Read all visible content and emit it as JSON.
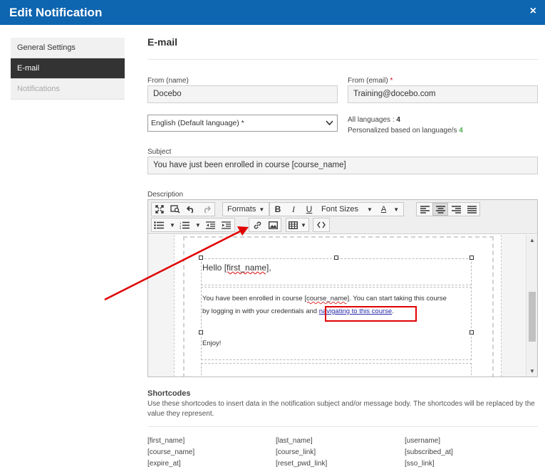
{
  "window": {
    "title": "Edit Notification",
    "close_glyph": "×"
  },
  "sidebar": {
    "items": [
      {
        "label": "General Settings",
        "state": "normal"
      },
      {
        "label": "E-mail",
        "state": "active"
      },
      {
        "label": "Notifications",
        "state": "disabled"
      }
    ]
  },
  "main": {
    "section_title": "E-mail",
    "from_name": {
      "label": "From (name)",
      "value": "Docebo"
    },
    "from_email": {
      "label": "From (email)",
      "required_mark": "*",
      "value": "Training@docebo.com"
    },
    "language": {
      "selected": "English (Default language) *"
    },
    "lang_info": {
      "all_label": "All languages :",
      "all_count": "4",
      "personalized_label": "Personalized based on language/s",
      "personalized_count": "4"
    },
    "subject": {
      "label": "Subject",
      "value": "You have just been enrolled in course [course_name]"
    },
    "description": {
      "label": "Description"
    }
  },
  "toolbar": {
    "formats_label": "Formats",
    "font_sizes_label": "Font Sizes",
    "bold": "B",
    "italic": "I",
    "underline": "U",
    "font_color": "A"
  },
  "editor_content": {
    "greeting_prefix": "Hello ",
    "greeting_var": "[first_name]",
    "greeting_suffix": ",",
    "line1_prefix": "You have been enrolled in course ",
    "line1_var": "[course_name]",
    "line1_suffix": ". You can start taking this course",
    "line2_prefix": "by logging in with your credentials and ",
    "line2_link": "navigating to this course",
    "line2_suffix": ".",
    "closing": "Enjoy!"
  },
  "shortcodes": {
    "title": "Shortcodes",
    "description": "Use these shortcodes to insert data in the notification subject and/or message body. The shortcodes will be replaced by the value they represent.",
    "codes": [
      "[first_name]",
      "[last_name]",
      "[username]",
      "[course_name]",
      "[course_link]",
      "[subscribed_at]",
      "[expire_at]",
      "[reset_pwd_link]",
      "[sso_link]"
    ]
  },
  "colors": {
    "titlebar": "#0e65b0",
    "sidebar_active": "#333333",
    "annotation_red": "#e00000",
    "count_green": "#4caf50"
  }
}
